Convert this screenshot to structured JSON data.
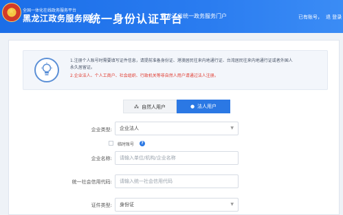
{
  "header": {
    "site_subtitle": "全国一体化在线政务服务平台",
    "site_name": "黑龙江政务服务网",
    "main_title": "统一身份认证平台",
    "portal_name": "黑龙江省统一政务服务门户",
    "account_link": "已有账号，",
    "logout_link": "退 登录"
  },
  "notice": {
    "line1": "1.注册个人账号时需要填写证件信息，请提前准备身份证、港澳居民往来内地通行证、台湾居民往来内地通行证或者外国人",
    "line2": "永久居留证。",
    "line3": "2.企业法人、个人工商户、社会组织、行政机关等非自然人用户请通过法人注册。"
  },
  "tabs": [
    {
      "label": "自然人用户",
      "icon": "person-group-icon",
      "active": false
    },
    {
      "label": "法人用户",
      "icon": "person-icon",
      "active": true
    }
  ],
  "form": {
    "enterprise_type_label": "企业类型:",
    "enterprise_type_value": "企业法人",
    "temp_account_label": "临时账号",
    "enterprise_name_label": "企业名称:",
    "enterprise_name_placeholder": "请输入单位/机构/企业名称",
    "credit_code_label": "统一社会信用代码:",
    "credit_code_placeholder": "请输入统一社会信用代码",
    "id_type_label": "证件类型:",
    "id_type_value": "身份证"
  },
  "colors": {
    "header_blue": "#1b6ee8",
    "active_tab": "#2b78e4",
    "warning_red": "#e03a2f"
  }
}
